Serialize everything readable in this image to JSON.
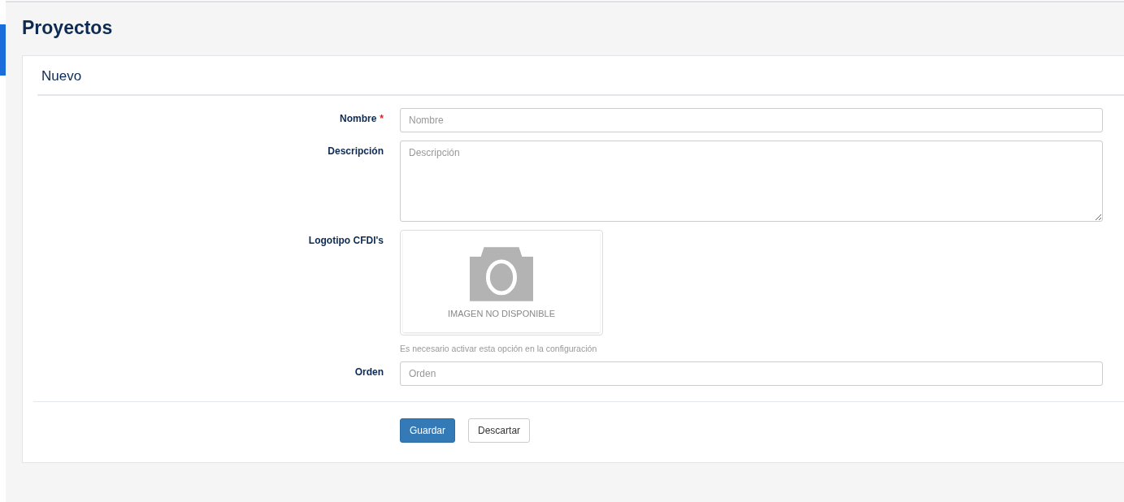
{
  "page_title": "Proyectos",
  "card": {
    "title": "Nuevo",
    "fields": [
      {
        "kind": "input",
        "label": "Nombre",
        "required_mark": "*",
        "placeholder": "Nombre"
      },
      {
        "kind": "textarea",
        "label": "Descripción",
        "placeholder": "Descripción"
      },
      {
        "kind": "image",
        "label": "Logotipo CFDI's",
        "image_text": "IMAGEN NO DISPONIBLE",
        "help": "Es necesario activar esta opción en la configuración"
      },
      {
        "kind": "input",
        "label": "Orden",
        "placeholder": "Orden"
      }
    ],
    "buttons": [
      {
        "kind": "primary",
        "label": "Guardar"
      },
      {
        "kind": "default",
        "label": "Descartar"
      }
    ]
  }
}
